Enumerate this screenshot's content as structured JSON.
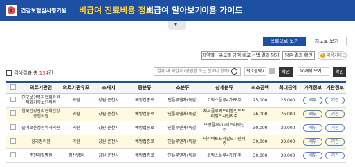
{
  "header": {
    "brand": "건강보험심사평가원",
    "tabs": [
      "비급여 진료비용 정보",
      "비급여 알아보기",
      "이용 가이드"
    ],
    "toggle_icon": "▾"
  },
  "view_buttons": {
    "list": "목록으로 보기",
    "map": "지도로 보기"
  },
  "actions": {
    "compare": "지역별 · 규모별 금액 비교",
    "put_selected": "선택 결과 담기",
    "view_saved": "담은 결과 확인",
    "info": "이용가이드",
    "info_icon": "!"
  },
  "results": {
    "label_prefix": "검색결과 총 ",
    "count": "134",
    "label_suffix": "건",
    "search_placeholder": "결과 내 재검색 (병원명 또는 진료비 항목)",
    "sort": "최소금액↑",
    "confirm": "확인",
    "per_page": "10개씩 보기"
  },
  "table": {
    "columns": [
      "",
      "의료기관명",
      "의료기관유모",
      "소재지",
      "중분류",
      "소분류",
      "상세분류",
      "최소금액",
      "최대금액",
      "가격정보",
      "기관정보"
    ],
    "rows": [
      {
        "name": "인구보건복지협회강원지회가족보건의원",
        "type": "의원",
        "location": "강원 춘천시",
        "mid": "예방접종료",
        "small": "인플루엔자(독감)",
        "detail": "코박스플루4가PF주",
        "min": "25,000",
        "max": "25,000",
        "price_btn": "세부",
        "org_btn": "기관"
      },
      {
        "name": "한국건강관리협회건강증진의원",
        "type": "의원",
        "location": "강원 춘천시",
        "mid": "예방접종료",
        "small": "인플루엔자(독감)",
        "detail": "지씨플루쿼드리밸런트프리필드시린지주",
        "min": "26,000",
        "max": "26,000",
        "price_btn": "세부",
        "org_btn": "기관"
      },
      {
        "name": "슬기로운정형외과의원",
        "type": "의원",
        "location": "강원 춘천시",
        "mid": "예방접종료",
        "small": "인플루엔자(독감)",
        "detail": "보령플루VIII테트라백신주",
        "min": "30,000",
        "max": "30,000",
        "price_btn": "세부",
        "org_btn": "기관"
      },
      {
        "name": "참가정의원",
        "type": "의원",
        "location": "강원 춘천시",
        "mid": "예방접종료",
        "small": "인플루엔자(독감)",
        "detail": "테라텍트프리필드시린지주",
        "min": "30,000",
        "max": "30,000",
        "price_btn": "세부",
        "org_btn": "기관"
      },
      {
        "name": "춘천재활병원",
        "type": "정신병원",
        "location": "강원 춘천시",
        "mid": "예방접종료",
        "small": "인플루엔자(독감)",
        "detail": "코박스플루4가PF주",
        "min": "30,000",
        "max": "30,000",
        "price_btn": "세부",
        "org_btn": "기관"
      }
    ]
  }
}
